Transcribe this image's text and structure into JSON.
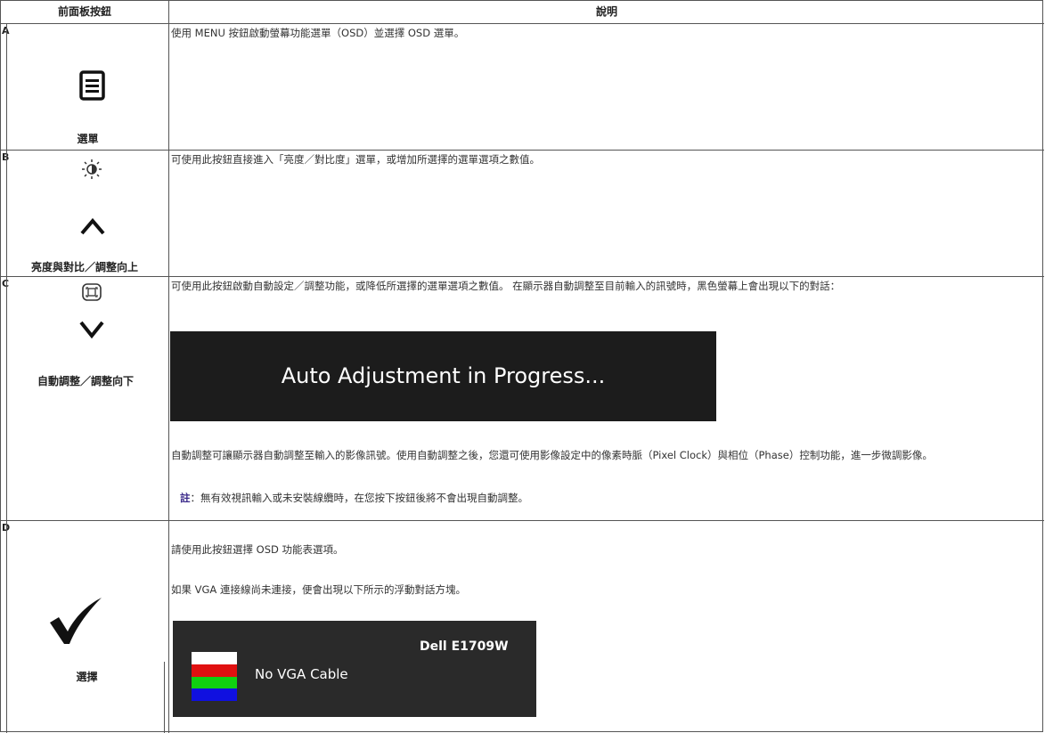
{
  "table": {
    "header": {
      "button_col": "前面板按鈕",
      "desc_col": "說明"
    },
    "rows": [
      {
        "letter": "A",
        "icon": "menu-icon",
        "label": "選單",
        "desc": "使用 MENU 按鈕啟動螢幕功能選單（OSD）並選擇 OSD 選單。"
      },
      {
        "letter": "B",
        "icon": "brightness-contrast-icon",
        "icon2": "chevron-up-icon",
        "label": "亮度與對比／調整向上",
        "desc": "可使用此按鈕直接進入「亮度／對比度」選單，或增加所選擇的選單選項之數值。"
      },
      {
        "letter": "C",
        "icon": "auto-adjust-icon",
        "icon2": "chevron-down-icon",
        "label": "自動調整／調整向下",
        "desc": "可使用此按鈕啟動自動設定／調整功能，或降低所選擇的選單選項之數值。 在顯示器自動調整至目前輸入的訊號時，黑色螢幕上會出現以下的對話：",
        "osd_text": "Auto Adjustment in Progress...",
        "desc2": "自動調整可讓顯示器自動調整至輸入的影像訊號。使用自動調整之後，您還可使用影像設定中的像素時脈（Pixel Clock）與相位（Phase）控制功能，進一步微調影像。",
        "note_label": "註",
        "note_text": "：無有效視訊輸入或未安裝線纜時，在您按下按鈕後將不會出現自動調整。"
      },
      {
        "letter": "D",
        "icon": "checkmark-icon",
        "label": "選擇",
        "desc": "請使用此按鈕選擇 OSD 功能表選項。",
        "desc2": "如果 VGA 連接線尚未連接，便會出現以下所示的浮動對話方塊。",
        "osd_msg": "No VGA Cable",
        "osd_brand": "Dell E1709W",
        "bar_colors": [
          "#ffffff",
          "#e01010",
          "#10d010",
          "#1010e0"
        ]
      }
    ]
  },
  "colors": {
    "border": "#555555",
    "note_label": "#3b2a8a",
    "osd_bg": "#1c1c1c"
  }
}
